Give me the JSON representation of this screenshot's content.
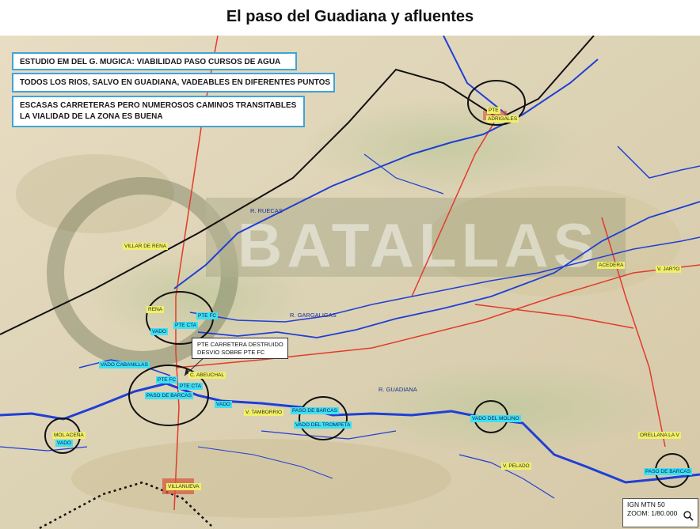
{
  "title": "El paso del Guadiana y afluentes",
  "notes": [
    [
      "ESTUDIO EM DEL G. MUGICA: VIABILIDAD PASO CURSOS DE AGUA"
    ],
    [
      "TODOS LOS RIOS, SALVO EN GUADIANA, VADEABLES EN DIFERENTES PUNTOS"
    ],
    [
      "ESCASAS CARRETERAS PERO NUMEROSOS CAMINOS TRANSITABLES",
      "LA VIALIDAD DE LA ZONA ES BUENA"
    ]
  ],
  "callout": [
    "PTE CARRETERA DESTRUIDO",
    "DESVIO SOBRE PTE FC"
  ],
  "watermark": "BATALLAS",
  "places": {
    "pte_adrigales": [
      "PTE",
      "ADRIGALES"
    ],
    "villar_de_rena": "VILLAR DE RENA",
    "rena": "RENA",
    "acedera": "ACEDERA",
    "v_jarceo": "V. JAR?O",
    "c_abeuchal": "C. ABEUCHAL",
    "villanueva": "VILLANUEVA",
    "orellana": "ORELLANA LA V",
    "mol_acena": "MOL ACEÑA",
    "vado_cabanillas": "VADO CABANILLAS"
  },
  "rivers": {
    "ruecas": "R. RUECAS",
    "gargaligas": "R. GARGALIGAS",
    "guadiana": "R. GUADIANA",
    "tamborrio": "V. TAMBORRIO",
    "pelado": "V. PELADO"
  },
  "crossings": {
    "pte_fc_1": "PTE FC",
    "pte_cta_1": "PTE CTA",
    "vado_1": "VADO",
    "pte_fc_2": "PTE FC",
    "pte_cta_2": "PTE CTA",
    "paso_barcas_1": "PASO DE BARCAS",
    "vado_2": "VADO",
    "paso_barcas_2": "PASO DE BARCAS",
    "vado_trompeta": "VADO DEL TROMPETA",
    "vado_molino": "VADO DEL MOLINO",
    "vado_3": "VADO",
    "paso_barcas_3": "PASO DE BARCAS"
  },
  "scale": [
    "IGN MTN 50",
    "ZOOM: 1/80.000"
  ],
  "colors": {
    "river": "#1f3fd6",
    "road": "#e23b2a",
    "railway": "#111111",
    "note_border": "#3fa4d8",
    "crossing_highlight": "#3fe0f0",
    "town_highlight": "#f0f06a"
  }
}
